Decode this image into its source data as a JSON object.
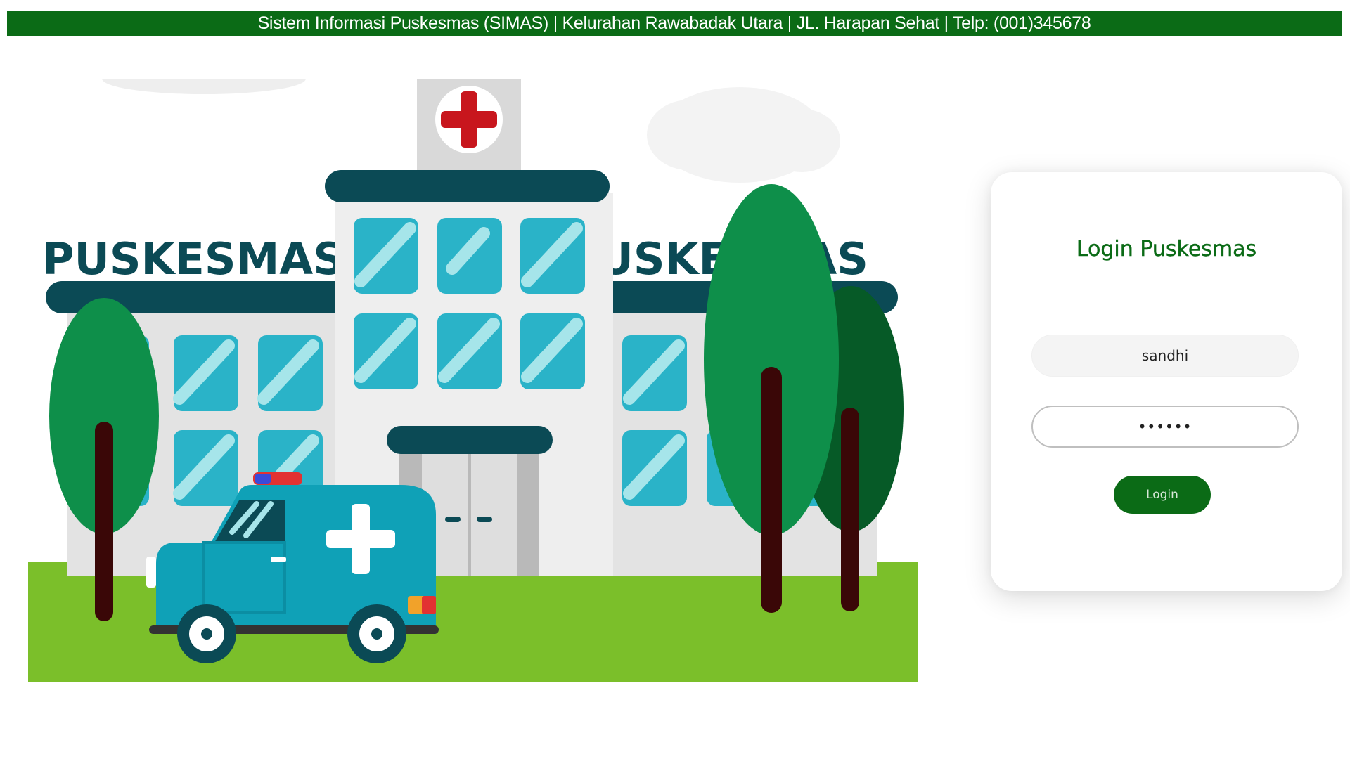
{
  "header": {
    "text": "Sistem Informasi Puskesmas (SIMAS) | Kelurahan Rawabadak Utara | JL. Harapan Sehat | Telp: (001)345678",
    "background_color": "#0b6b16"
  },
  "illustration": {
    "sign_left": "PUSKESMAS",
    "sign_right": "PUSKESMAS"
  },
  "login": {
    "title": "Login Puskesmas",
    "username_value": "sandhi",
    "password_value": "••••••",
    "button_label": "Login",
    "accent_color": "#0b6b16"
  }
}
